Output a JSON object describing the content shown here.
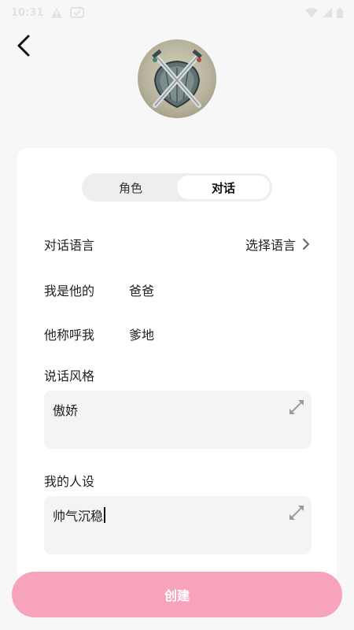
{
  "status_bar": {
    "time": "10:31"
  },
  "tabs": [
    {
      "label": "角色"
    },
    {
      "label": "对话"
    }
  ],
  "form": {
    "language": {
      "label": "对话语言",
      "value": "选择语言"
    },
    "relation": {
      "label": "我是他的",
      "value": "爸爸"
    },
    "address": {
      "label": "他称呼我",
      "value": "爹地"
    },
    "style": {
      "label": "说话风格",
      "value": "傲娇"
    },
    "persona": {
      "label": "我的人设",
      "value": "帅气沉稳"
    }
  },
  "create_button": {
    "label": "创建"
  },
  "colors": {
    "accent": "#f6a3bb",
    "background": "#f7f7f8",
    "card": "#ffffff",
    "field": "#f4f4f4"
  },
  "icons": [
    "back-arrow-icon",
    "expand-icon",
    "chevron-right-icon",
    "wifi-icon",
    "signal-icon",
    "battery-icon",
    "warning-icon"
  ]
}
